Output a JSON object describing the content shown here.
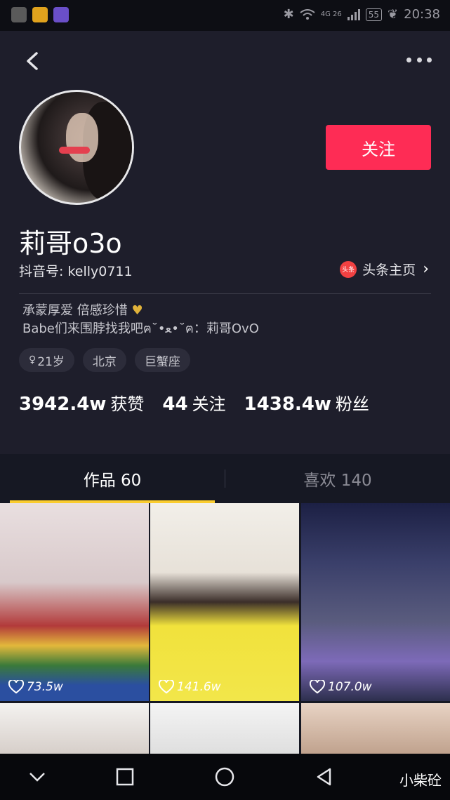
{
  "status_bar": {
    "network": "4G 26",
    "battery": "55",
    "time": "20:38",
    "icons": [
      "cat-app-icon",
      "mail-app-icon",
      "video-app-icon",
      "bluetooth-icon",
      "wifi-icon",
      "signal-icon",
      "battery-icon",
      "leaf-icon"
    ]
  },
  "header": {
    "back_icon": "chevron-left-icon",
    "more_icon": "more-dots-icon"
  },
  "profile": {
    "nickname": "莉哥o3o",
    "douyin_id": "抖音号: kelly0711",
    "follow_label": "关注",
    "toutiao_badge": "头条",
    "toutiao_label": "头条主页",
    "bio_line1": "承蒙厚爱 倍感珍惜",
    "bio_line2": "Babe们来围脖找我吧ฅ˘•ﻌ•˘ฅ：莉哥OvO",
    "tags": [
      "21岁",
      "北京",
      "巨蟹座"
    ],
    "stats": [
      {
        "value": "3942.4w",
        "label": "获赞"
      },
      {
        "value": "44",
        "label": "关注"
      },
      {
        "value": "1438.4w",
        "label": "粉丝"
      }
    ]
  },
  "tabs": {
    "works": "作品 60",
    "likes": "喜欢 140"
  },
  "videos": [
    {
      "likes": "73.5w"
    },
    {
      "likes": "141.6w"
    },
    {
      "likes": "107.0w"
    },
    {
      "likes": ""
    },
    {
      "likes": ""
    },
    {
      "likes": ""
    }
  ],
  "nav": {
    "watermark": "小柴砼"
  },
  "colors": {
    "accent": "#fe2c55",
    "tab_indicator": "#facc2e",
    "background": "#161823"
  }
}
